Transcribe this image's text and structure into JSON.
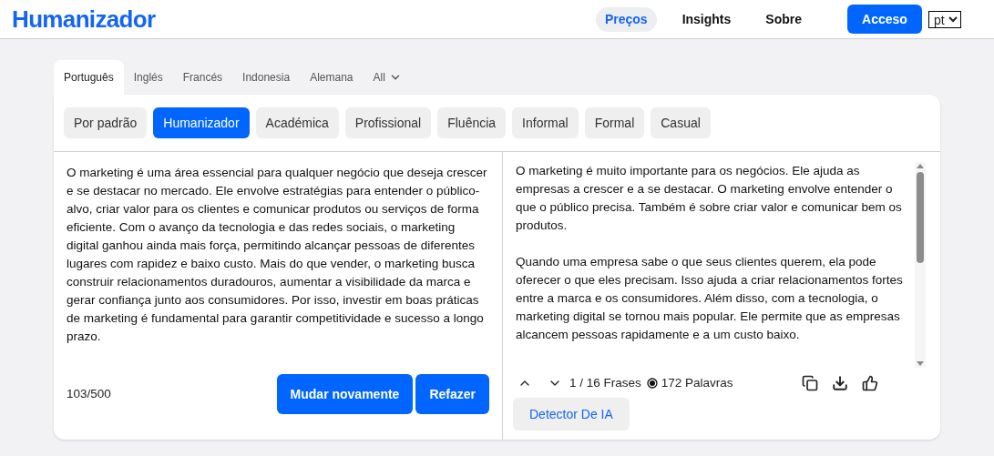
{
  "header": {
    "logo": "Humanizador",
    "nav": [
      {
        "label": "Preços",
        "selected": true
      },
      {
        "label": "Insights",
        "selected": false
      },
      {
        "label": "Sobre",
        "selected": false
      }
    ],
    "login_button": "Acceso",
    "language_select": "pt"
  },
  "language_tabs": [
    {
      "label": "Português",
      "selected": true
    },
    {
      "label": "Inglés",
      "selected": false
    },
    {
      "label": "Francés",
      "selected": false
    },
    {
      "label": "Indonesia",
      "selected": false
    },
    {
      "label": "Alemana",
      "selected": false
    },
    {
      "label": "All",
      "selected": false,
      "kind": "dropdown"
    }
  ],
  "modes": [
    {
      "label": "Por padrão",
      "selected": false
    },
    {
      "label": "Humanizador",
      "selected": true
    },
    {
      "label": "Académica",
      "selected": false
    },
    {
      "label": "Profissional",
      "selected": false
    },
    {
      "label": "Fluência",
      "selected": false
    },
    {
      "label": "Informal",
      "selected": false
    },
    {
      "label": "Formal",
      "selected": false
    },
    {
      "label": "Casual",
      "selected": false
    }
  ],
  "input": {
    "text": "O marketing é uma área essencial para qualquer negócio que deseja crescer e se destacar no mercado. Ele envolve estratégias para entender o público-alvo, criar valor para os clientes e comunicar produtos ou serviços de forma eficiente. Com o avanço da tecnologia e das redes sociais, o marketing digital ganhou ainda mais força, permitindo alcançar pessoas de diferentes lugares com rapidez e baixo custo. Mais do que vender, o marketing busca construir relacionamentos duradouros, aumentar a visibilidade da marca e gerar confiança junto aos consumidores. Por isso, investir em boas práticas de marketing é fundamental para garantir competitividade e sucesso a longo prazo.",
    "counter": "103/500",
    "buttons": [
      "Mudar novamente",
      "Refazer"
    ]
  },
  "output": {
    "paragraphs": [
      "O marketing é muito importante para os negócios. Ele ajuda as empresas a crescer e a se destacar. O marketing envolve entender o que o público precisa. Também é sobre criar valor e comunicar bem os produtos.",
      "Quando uma empresa sabe o que seus clientes querem, ela pode oferecer o que eles precisam. Isso ajuda a criar relacionamentos fortes entre a marca e os consumidores. Além disso, com a tecnologia, o marketing digital se tornou mais popular. Ele permite que as empresas alcancem pessoas rapidamente e a um custo baixo."
    ],
    "sentences": "1 / 16 Frases",
    "words": "172 Palavras",
    "detector_button": "Detector De IA"
  }
}
